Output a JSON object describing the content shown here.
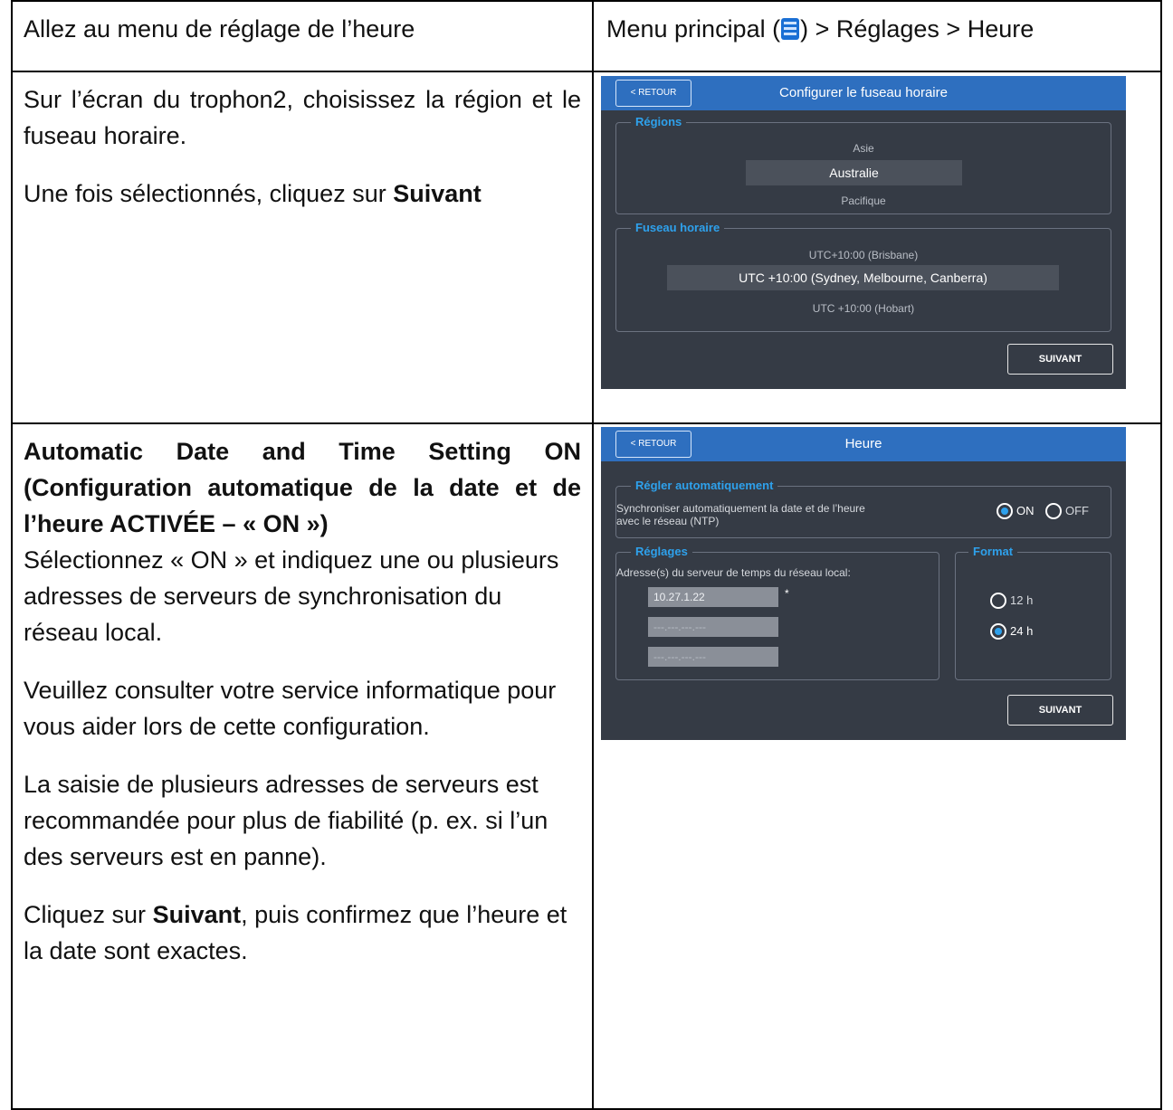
{
  "row1": {
    "left": "Allez au menu de réglage de l’heure",
    "right_prefix": "Menu principal (",
    "right_suffix": ") > Réglages > Heure",
    "menu_icon": "hamburger-menu-icon"
  },
  "row2": {
    "para1": "Sur l’écran du trophon2, choisissez la région et le fuseau horaire.",
    "para2_prefix": "Une fois sélectionnés, cliquez sur ",
    "para2_bold": "Suivant",
    "screen": {
      "back": "< RETOUR",
      "title": "Configurer le fuseau horaire",
      "regions_legend": "Régions",
      "regions": [
        "Asie",
        "Australie",
        "Pacifique"
      ],
      "timezone_legend": "Fuseau horaire",
      "timezones": [
        "UTC+10:00 (Brisbane)",
        "UTC +10:00 (Sydney, Melbourne, Canberra)",
        "UTC +10:00 (Hobart)"
      ],
      "next": "SUIVANT"
    }
  },
  "row3": {
    "heading": "Automatic Date and Time Setting ON (Configuration automatique de la date et de l’heure ACTIVÉE – « ON »)",
    "para1": "Sélectionnez « ON » et indiquez une ou plusieurs adresses de serveurs de synchronisation du réseau local.",
    "para2": "Veuillez consulter votre service informatique pour vous aider lors de cette configuration.",
    "para3": "La saisie de plusieurs adresses de serveurs est recommandée pour plus de fiabilité (p. ex. si l’un des serveurs est en panne).",
    "para4_prefix": "Cliquez sur ",
    "para4_bold": "Suivant",
    "para4_suffix": ", puis confirmez que l’heure et la date sont exactes.",
    "screen": {
      "back": "< RETOUR",
      "title": "Heure",
      "auto_legend": "Régler automatiquement",
      "auto_text": "Synchroniser automatiquement la date et de l’heure avec le réseau (NTP)",
      "on_label": "ON",
      "off_label": "OFF",
      "auto_value": "ON",
      "settings_legend": "Réglages",
      "server_label": "Adresse(s) du serveur de temps du réseau local:",
      "server1": "10.27.1.22",
      "server_placeholder": "---.---.---.---",
      "required_mark": "*",
      "format_legend": "Format",
      "format_12": "12 h",
      "format_24": "24 h",
      "format_value": "24 h",
      "next": "SUIVANT"
    }
  }
}
